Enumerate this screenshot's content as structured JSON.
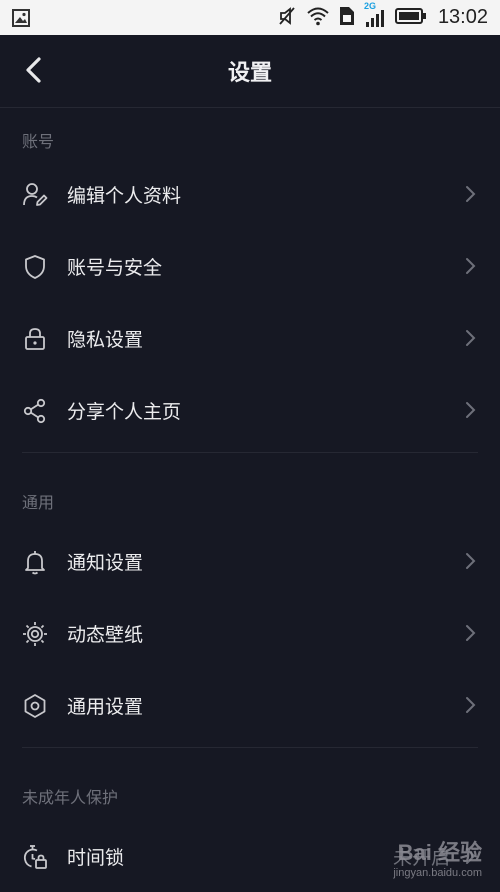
{
  "status_bar": {
    "time": "13:02",
    "network": "2G",
    "icons": [
      "gallery-icon",
      "mute-icon",
      "wifi-icon",
      "sim-icon",
      "signal-icon",
      "battery-icon"
    ]
  },
  "header": {
    "title": "设置",
    "back_icon": "chevron-left-icon"
  },
  "sections": [
    {
      "title": "账号",
      "items": [
        {
          "label": "编辑个人资料",
          "icon": "edit-profile-icon"
        },
        {
          "label": "账号与安全",
          "icon": "shield-icon"
        },
        {
          "label": "隐私设置",
          "icon": "lock-icon"
        },
        {
          "label": "分享个人主页",
          "icon": "share-icon"
        }
      ]
    },
    {
      "title": "通用",
      "items": [
        {
          "label": "通知设置",
          "icon": "bell-icon"
        },
        {
          "label": "动态壁纸",
          "icon": "wallpaper-icon"
        },
        {
          "label": "通用设置",
          "icon": "settings-hex-icon"
        }
      ]
    },
    {
      "title": "未成年人保护",
      "items": [
        {
          "label": "时间锁",
          "icon": "timer-lock-icon",
          "value": "未开启"
        }
      ]
    }
  ],
  "watermark": {
    "brand": "Bai 经验",
    "site": "jingyan.baidu.com"
  },
  "colors": {
    "background": "#161823",
    "status_bar": "#f4f4f4",
    "text_primary": "#ececee",
    "text_secondary": "#6e707a",
    "divider": "#262833",
    "network_badge": "#1aa0e0"
  }
}
